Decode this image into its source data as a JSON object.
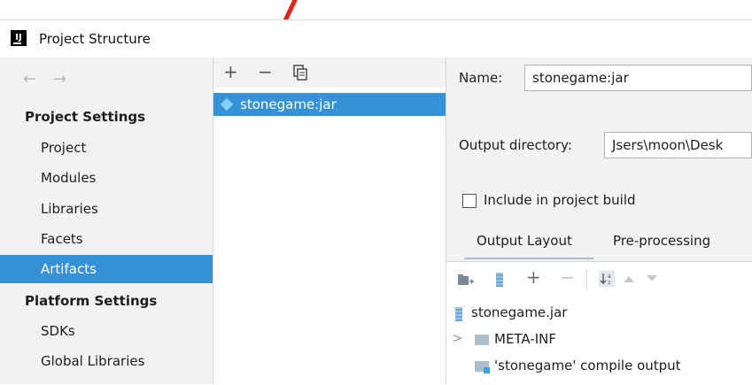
{
  "window": {
    "title": "Project Structure",
    "app_icon_text": "IJ"
  },
  "sidebar": {
    "back_arrow": "←",
    "forward_arrow": "→",
    "project_settings_header": "Project Settings",
    "project_items": [
      {
        "label": "Project"
      },
      {
        "label": "Modules"
      },
      {
        "label": "Libraries"
      },
      {
        "label": "Facets"
      },
      {
        "label": "Artifacts",
        "selected": true
      }
    ],
    "platform_settings_header": "Platform Settings",
    "platform_items": [
      {
        "label": "SDKs"
      },
      {
        "label": "Global Libraries"
      }
    ]
  },
  "artifacts_toolbar": {
    "add": "+",
    "remove": "−"
  },
  "artifacts": [
    {
      "label": "stonegame:jar",
      "selected": true
    }
  ],
  "details": {
    "name_label": "Name:",
    "name_value": "stonegame:jar",
    "output_dir_label": "Output directory:",
    "output_dir_value": "Jsers\\moon\\Desk",
    "include_build_label": "Include in project build",
    "include_build_checked": false,
    "tabs": [
      {
        "label": "Output Layout",
        "active": true
      },
      {
        "label": "Pre-processing"
      }
    ]
  },
  "layout_toolbar": {
    "add": "+",
    "remove": "−"
  },
  "layout_tree": [
    {
      "label": "stonegame.jar"
    },
    {
      "label": "META-INF",
      "expander": ">"
    },
    {
      "label": "'stonegame' compile output"
    }
  ],
  "colors": {
    "selection": "#3592d8",
    "annotation": "#e8211b"
  }
}
